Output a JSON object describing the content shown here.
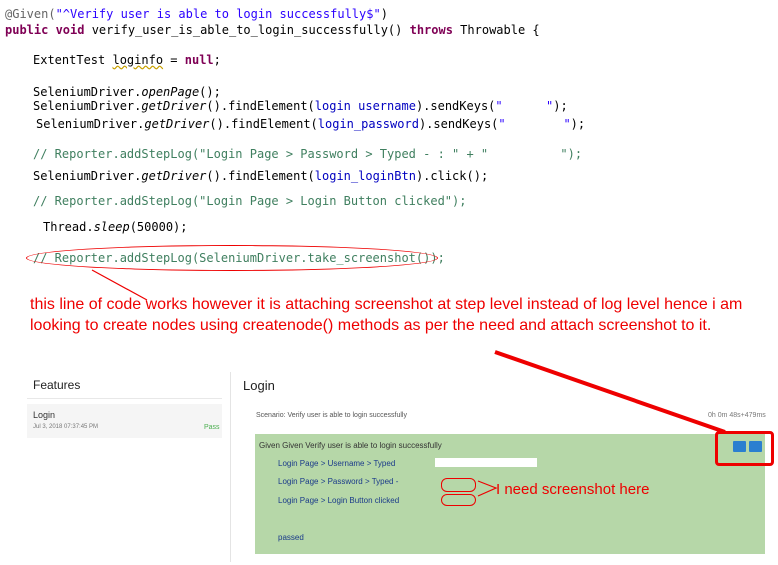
{
  "code_lines": [
    {
      "segs": [
        {
          "c": "ann",
          "t": "@Given("
        },
        {
          "c": "str",
          "t": "\"^Verify user is able to login successfully$\""
        },
        {
          "c": "",
          "t": ")"
        }
      ]
    },
    {
      "segs": [
        {
          "c": "kw",
          "t": "public void "
        },
        {
          "c": "",
          "t": "verify_user_is_able_to_login_successfully() "
        },
        {
          "c": "kw",
          "t": "throws "
        },
        {
          "c": "",
          "t": "Throwable {"
        }
      ]
    },
    {
      "segs": [
        {
          "c": "",
          "t": "ExtentTest "
        },
        {
          "c": "ul",
          "t": "loginfo"
        },
        {
          "c": "",
          "t": " = "
        },
        {
          "c": "kw",
          "t": "null"
        },
        {
          "c": "",
          "t": ";"
        }
      ]
    },
    {
      "segs": [
        {
          "c": "",
          "t": "SeleniumDriver."
        },
        {
          "c": "it",
          "t": "openPage"
        },
        {
          "c": "",
          "t": "();"
        }
      ]
    },
    {
      "segs": [
        {
          "c": "",
          "t": "SeleniumDriver."
        },
        {
          "c": "it",
          "t": "getDriver"
        },
        {
          "c": "",
          "t": "().findElement("
        },
        {
          "c": "fld",
          "t": "login username"
        },
        {
          "c": "",
          "t": ").sendKeys("
        },
        {
          "c": "str",
          "t": "\"      \""
        },
        {
          "c": "",
          "t": ");"
        }
      ]
    },
    {
      "segs": [
        {
          "c": "",
          "t": "SeleniumDriver."
        },
        {
          "c": "it",
          "t": "getDriver"
        },
        {
          "c": "",
          "t": "().findElement("
        },
        {
          "c": "fld",
          "t": "login_password"
        },
        {
          "c": "",
          "t": ").sendKeys("
        },
        {
          "c": "str",
          "t": "\"        \""
        },
        {
          "c": "",
          "t": ");"
        }
      ]
    },
    {
      "segs": [
        {
          "c": "cm",
          "t": "// Reporter.addStepLog(\"Login Page > Password > Typed - : \" + \"          \");"
        }
      ]
    },
    {
      "segs": [
        {
          "c": "",
          "t": "SeleniumDriver."
        },
        {
          "c": "it",
          "t": "getDriver"
        },
        {
          "c": "",
          "t": "().findElement("
        },
        {
          "c": "fld",
          "t": "login_loginBtn"
        },
        {
          "c": "",
          "t": ").click();"
        }
      ]
    },
    {
      "segs": [
        {
          "c": "cm",
          "t": "// Reporter.addStepLog(\"Login Page > Login Button clicked\");"
        }
      ]
    },
    {
      "segs": [
        {
          "c": "",
          "t": "Thread."
        },
        {
          "c": "it",
          "t": "sleep"
        },
        {
          "c": "",
          "t": "(50000);"
        }
      ]
    },
    {
      "segs": [
        {
          "c": "cm",
          "t": "// Reporter.addStepLog(SeleniumDriver.take_screenshot());"
        }
      ]
    }
  ],
  "note": "this line of code works however it is attaching screenshot at step level instead of log level hence i am looking to create nodes using createnode() methods as per the need and attach screenshot to it.",
  "report": {
    "features_title": "Features",
    "feature_name": "Login",
    "feature_date": "Jul 3, 2018 07:37:45 PM",
    "feature_status": "Pass",
    "login_title": "Login",
    "scenario": "Scenario: Verify user is able to login successfully",
    "scenario_time": "0h 0m 48s+479ms",
    "given": "Given  Given Verify user is able to login successfully",
    "steps": [
      "Login Page > Username > Typed",
      "Login Page > Password > Typed -",
      "Login Page > Login Button clicked"
    ],
    "passed": "passed"
  },
  "need_label": "I need screenshot here",
  "colors": {
    "annotation_red": "#ee0000",
    "step_green": "#b6d7a8"
  }
}
